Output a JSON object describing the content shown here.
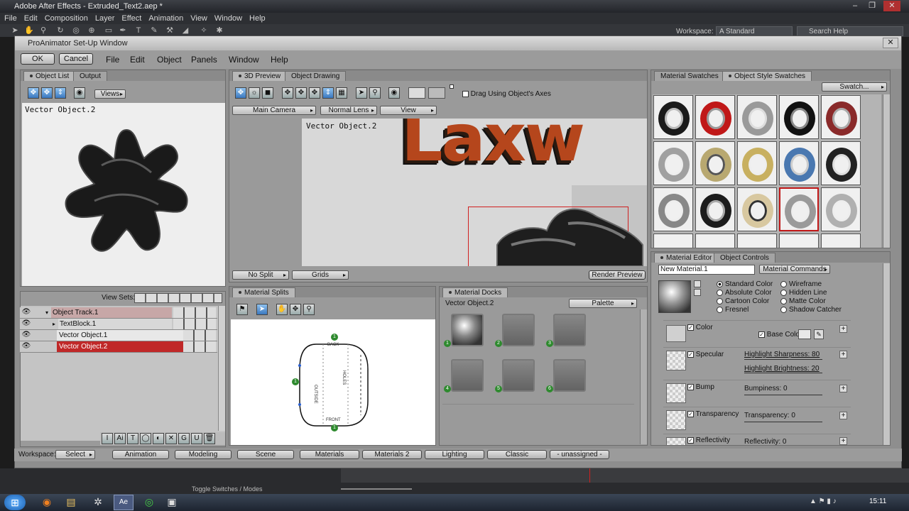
{
  "ae": {
    "title": "Adobe After Effects - Extruded_Text2.aep *",
    "menu": [
      "File",
      "Edit",
      "Composition",
      "Layer",
      "Effect",
      "Animation",
      "View",
      "Window",
      "Help"
    ],
    "workspace_label": "Workspace:",
    "workspace_value": "A Standard",
    "search_placeholder": "Search Help",
    "toggle_label": "Toggle Switches / Modes"
  },
  "pa": {
    "title": "ProAnimator Set-Up Window",
    "ok": "OK",
    "cancel": "Cancel",
    "menu": [
      "File",
      "Edit",
      "Object",
      "Panels",
      "Window",
      "Help"
    ]
  },
  "object_list": {
    "tabs": [
      "Object List",
      "Output"
    ],
    "views_label": "Views",
    "preview_label": "Vector Object.2",
    "view_sets_label": "View Sets:",
    "rows": [
      {
        "name": "Object Track.1"
      },
      {
        "name": "TextBlock.1"
      },
      {
        "name": "Vector Object.1"
      },
      {
        "name": "Vector Object.2"
      }
    ],
    "bottom_tools": [
      "I",
      "Ai",
      "T",
      "◯",
      "◐",
      "✕",
      "G",
      "U",
      "🗑"
    ]
  },
  "preview": {
    "tabs": [
      "3D Preview",
      "Object Drawing"
    ],
    "drag_axes_label": "Drag Using Object's Axes",
    "camera": "Main Camera",
    "lens": "Normal Lens",
    "view": "View",
    "viewport_label": "Vector Object.2",
    "scene_text": "Laxw",
    "no_split": "No Split",
    "grids": "Grids",
    "render_preview": "Render Preview"
  },
  "splits": {
    "tab": "Material Splits",
    "back": "BACK",
    "front": "FRONT",
    "outside": "OUTSIDE",
    "holes": "HOLES",
    "markers": [
      "1",
      "1",
      "1"
    ]
  },
  "docks": {
    "tab": "Material Docks",
    "label": "Vector Object.2",
    "palette": "Palette",
    "numbers": [
      "1",
      "2",
      "3",
      "4",
      "5",
      "6"
    ]
  },
  "swatches": {
    "tabs": [
      "Material Swatches",
      "Object Style Swatches"
    ],
    "swatch_button": "Swatch...",
    "colors": [
      "#1a1a1a",
      "#c01818",
      "#9a9a9a",
      "#111111",
      "#8a2a2a",
      "#a0a0a0",
      "#b8a870",
      "#c8b060",
      "#4a78b0",
      "#222222",
      "#888888",
      "#1c1c1c",
      "#d8c8a0",
      "#9a9a9a",
      "#b0b0b0"
    ]
  },
  "material_editor": {
    "tabs": [
      "Material Editor",
      "Object Controls"
    ],
    "material_name": "New Material.1",
    "commands": "Material Commands",
    "radios_left": [
      "Standard Color",
      "Absolute Color",
      "Cartoon Color",
      "Fresnel"
    ],
    "radios_right": [
      "Wireframe",
      "Hidden Line",
      "Matte Color",
      "Shadow Catcher"
    ],
    "rows": [
      {
        "name": "Color",
        "param": "Base Color"
      },
      {
        "name": "Specular",
        "param": "Highlight Sharpness: 80",
        "param2": "Highlight Brightness: 20"
      },
      {
        "name": "Bump",
        "param": "Bumpiness: 0"
      },
      {
        "name": "Transparency",
        "param": "Transparency: 0"
      },
      {
        "name": "Reflectivity",
        "param": "Reflectivity: 0"
      }
    ]
  },
  "workspace_bar": {
    "label": "Workspace:",
    "select": "Select",
    "buttons": [
      "Animation",
      "Modeling",
      "Scene",
      "Materials",
      "Materials 2",
      "Lighting",
      "Classic",
      "- unassigned -"
    ]
  },
  "taskbar": {
    "time": "15:11"
  }
}
